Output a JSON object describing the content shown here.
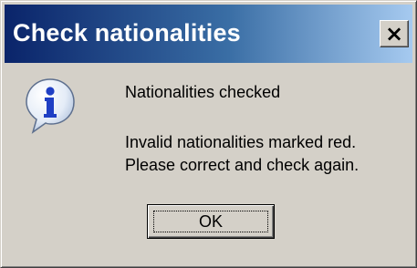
{
  "dialog": {
    "title": "Check nationalities",
    "close_label": "×",
    "icon": "information-icon",
    "message_heading": "Nationalities checked",
    "message_line1": "Invalid nationalities marked red.",
    "message_line2": "Please correct and check again.",
    "ok_label": "OK"
  },
  "colors": {
    "titlebar_start": "#0a246a",
    "titlebar_end": "#a6caf0",
    "face": "#d4d0c8"
  }
}
